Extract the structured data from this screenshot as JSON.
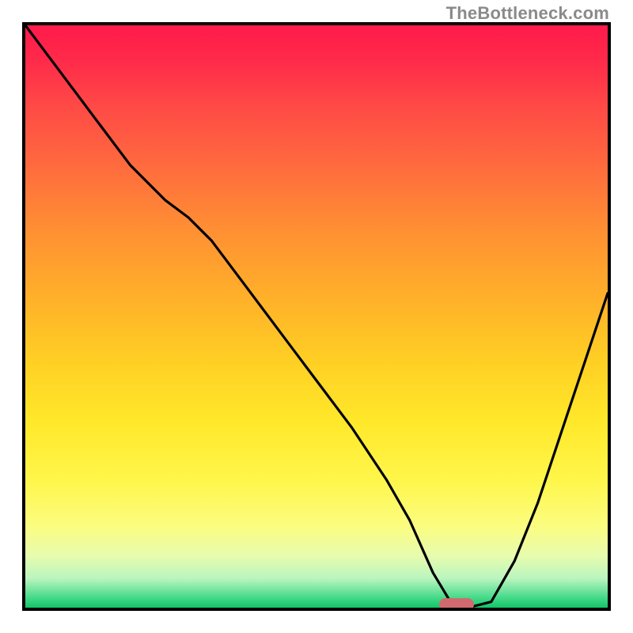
{
  "watermark": "TheBottleneck.com",
  "colors": {
    "border": "#000000",
    "curve": "#000000",
    "marker": "#d06a6e",
    "gradient_top": "#ff1a4b",
    "gradient_mid": "#ffd024",
    "gradient_bottom": "#12c668"
  },
  "chart_data": {
    "type": "line",
    "title": "",
    "xlabel": "",
    "ylabel": "",
    "xlim": [
      0,
      100
    ],
    "ylim": [
      0,
      100
    ],
    "grid": false,
    "legend": false,
    "background": "rainbow-vertical-gradient",
    "series": [
      {
        "name": "bottleneck-curve",
        "x": [
          0,
          6,
          12,
          18,
          24,
          28,
          32,
          38,
          44,
          50,
          56,
          62,
          66,
          70,
          73,
          76,
          80,
          84,
          88,
          92,
          96,
          100
        ],
        "y": [
          100,
          92,
          84,
          76,
          70,
          67,
          63,
          55,
          47,
          39,
          31,
          22,
          15,
          6,
          1,
          0,
          1,
          8,
          18,
          30,
          42,
          54
        ]
      }
    ],
    "marker": {
      "x": 74,
      "y": 0.5,
      "shape": "pill",
      "color": "#d06a6e"
    }
  }
}
